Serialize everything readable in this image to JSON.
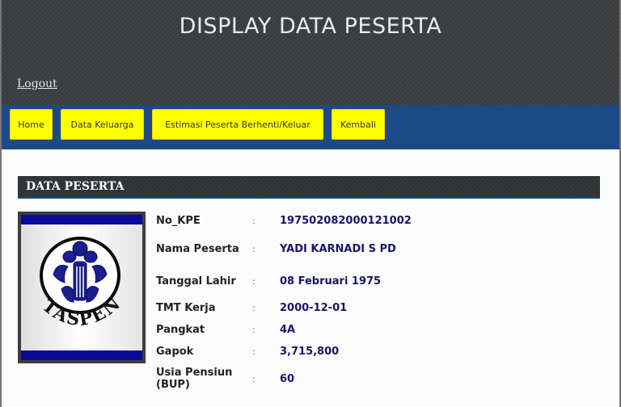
{
  "header": {
    "title": "DISPLAY DATA PESERTA",
    "logout_label": "Logout"
  },
  "nav": {
    "items": [
      {
        "label": "Home"
      },
      {
        "label": "Data Keluarga"
      },
      {
        "label": "Estimasi Peserta Berhenti/Keluar"
      },
      {
        "label": "Kembali"
      }
    ]
  },
  "section": {
    "title": "DATA PESERTA"
  },
  "logo": {
    "text": "TASPEN"
  },
  "fields": [
    {
      "label": "No_KPE",
      "sep": ":",
      "value": "197502082000121002"
    },
    {
      "label": "Nama Peserta",
      "sep": ":",
      "value": "YADI KARNADI S PD"
    },
    {
      "label": "Tanggal Lahir",
      "sep": ":",
      "value": "08 Februari 1975"
    },
    {
      "label": "TMT Kerja",
      "sep": ":",
      "value": "2000-12-01"
    },
    {
      "label": "Pangkat",
      "sep": ":",
      "value": "4A"
    },
    {
      "label": "Gapok",
      "sep": ":",
      "value": "3,715,800"
    },
    {
      "label": "Usia Pensiun (BUP)",
      "sep": ":",
      "value": "60"
    }
  ],
  "colors": {
    "header_bg": "#3a3d3e",
    "navbar_bg": "#1d4a86",
    "nav_button_bg": "#ffff00",
    "value_text": "#16166a"
  }
}
